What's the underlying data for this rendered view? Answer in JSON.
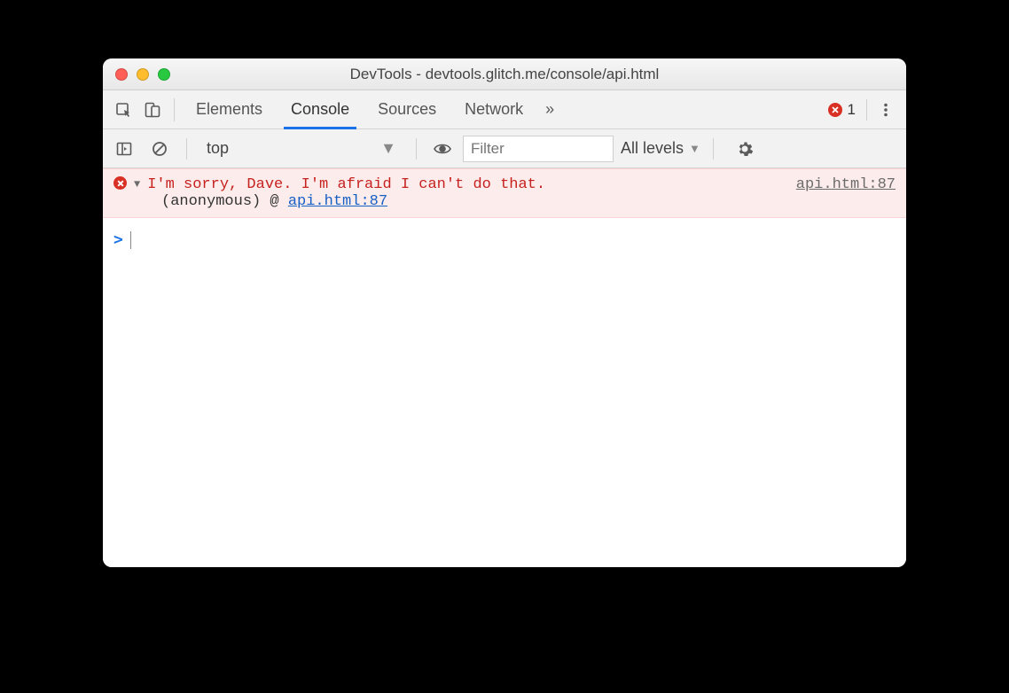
{
  "window": {
    "title_prefix": "DevTools - ",
    "title_url": "devtools.glitch.me/console/api.html"
  },
  "tabs": {
    "items": [
      "Elements",
      "Console",
      "Sources",
      "Network"
    ],
    "active_index": 1,
    "overflow_glyph": "»",
    "error_count": "1"
  },
  "console_toolbar": {
    "context_label": "top",
    "filter_placeholder": "Filter",
    "levels_label": "All levels"
  },
  "console": {
    "error": {
      "message": "I'm sorry, Dave. I'm afraid I can't do that.",
      "source_location": "api.html:87",
      "stack_anon": "(anonymous)",
      "stack_at": "@",
      "stack_link": "api.html:87"
    },
    "prompt_glyph": ">"
  },
  "icons": {
    "inspect": "inspect-icon",
    "device": "device-icon",
    "kebab": "kebab-icon",
    "play_frame": "execution-context-icon",
    "clear": "clear-console-icon",
    "eye": "live-expression-icon",
    "gear": "settings-icon",
    "caret_down": "▼"
  }
}
